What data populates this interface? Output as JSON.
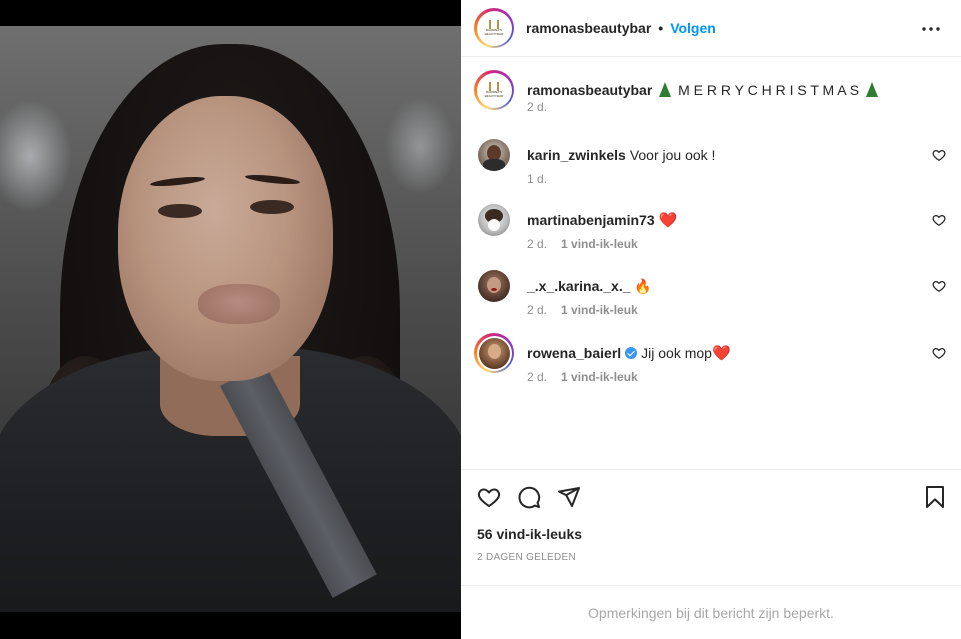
{
  "post": {
    "username": "ramonasbeautybar",
    "separator": "•",
    "follow_label": "Volgen",
    "logo_text": "RAMONA'S BEAUTYBAR"
  },
  "caption": {
    "username": "ramonasbeautybar",
    "text": "M E R R Y C H R I S T M A S",
    "time": "2 d."
  },
  "comments": [
    {
      "username": "karin_zwinkels",
      "text": "Voor jou ook !",
      "time": "1 d.",
      "likes": ""
    },
    {
      "username": "martinabenjamin73",
      "text": "",
      "emoji": "❤️",
      "time": "2 d.",
      "likes": "1 vind-ik-leuk"
    },
    {
      "username": "_.x_.karina._x._",
      "text": "",
      "emoji": "🔥",
      "time": "2 d.",
      "likes": "1 vind-ik-leuk"
    },
    {
      "username": "rowena_baierl",
      "text": "Jij ook mop",
      "emoji": "❤️",
      "verified": true,
      "time": "2 d.",
      "likes": "1 vind-ik-leuk"
    }
  ],
  "actions": {
    "like_icon": "heart-icon",
    "comment_icon": "comment-icon",
    "share_icon": "paper-plane-icon",
    "save_icon": "bookmark-icon"
  },
  "likes_count": "56 vind-ik-leuks",
  "posted": "2 DAGEN GELEDEN",
  "restricted_notice": "Opmerkingen bij dit bericht zijn beperkt.",
  "colors": {
    "follow_blue": "#0095f6",
    "muted_text": "#8e8e8e",
    "border": "#efefef",
    "verified": "#3897f0"
  }
}
